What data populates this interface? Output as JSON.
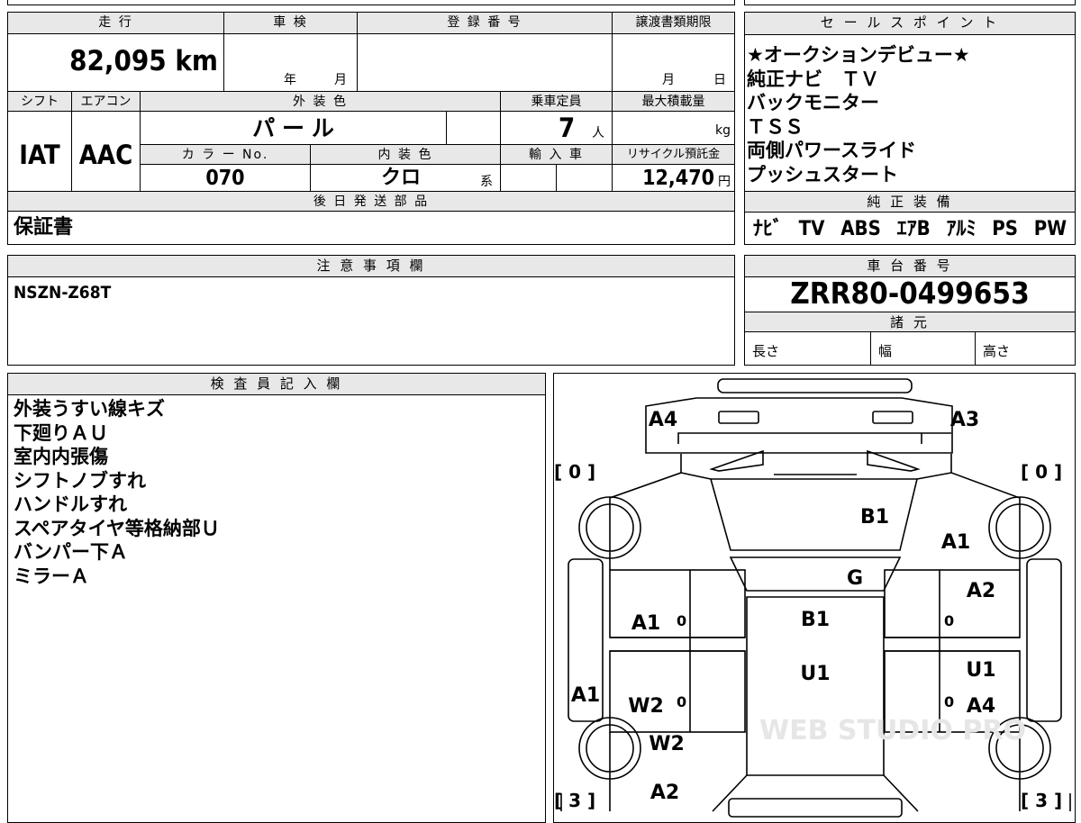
{
  "top_info": {
    "headers": {
      "mileage": "走 行",
      "inspection": "車 検",
      "registration": "登 録 番 号",
      "transfer_deadline": "譲渡書類期限"
    },
    "mileage_value": "82,095 km",
    "inspection_year": "年",
    "inspection_month": "月",
    "transfer_month": "月",
    "transfer_day": "日",
    "headers2": {
      "shift": "シフト",
      "ac": "エアコン",
      "exterior": "外 装 色",
      "capacity": "乗車定員",
      "max_load": "最大積載量"
    },
    "shift_value": "IAT",
    "ac_value": "AAC",
    "exterior_value": "パ ー ル",
    "capacity_value": "7",
    "capacity_unit": "人",
    "load_unit": "kg",
    "headers3": {
      "color_no": "カ ラ ー No.",
      "interior": "内 装 色",
      "import": "輸 入 車",
      "recycle": "リサイクル預託金"
    },
    "color_no_value": "070",
    "interior_value": "クロ",
    "interior_suffix": "系",
    "recycle_value": "12,470",
    "recycle_unit": "円"
  },
  "later_parts": {
    "header": "後 日 発 送 部 品",
    "value": "保証書"
  },
  "sales_points": {
    "header": "セ ー ル ス ポ イ ン ト",
    "lines": [
      "★オークションデビュー★",
      "純正ナビ　ＴＶ",
      "バックモニター",
      "ＴＳＳ",
      "両側パワースライド",
      "プッシュスタート"
    ]
  },
  "genuine": {
    "header": "純 正 装 備",
    "items": [
      "ﾅﾋﾞ",
      "TV",
      "ABS",
      "ｴｱB",
      "ｱﾙﾐ",
      "PS",
      "PW"
    ]
  },
  "notes": {
    "header": "注 意 事 項 欄",
    "value": "NSZN-Z68T"
  },
  "chassis": {
    "header": "車 台 番 号",
    "value": "ZRR80-0499653",
    "spec_header": "諸 元",
    "length": "長さ",
    "width": "幅",
    "height": "高さ"
  },
  "inspector": {
    "header": "検 査 員 記 入 欄",
    "lines": [
      "外装うすい線キズ",
      "下廻りＡＵ",
      "室内内張傷",
      "シフトノブすれ",
      "ハンドルすれ",
      "スペアタイヤ等格納部Ｕ",
      "バンパー下Ａ",
      "ミラーＡ"
    ]
  },
  "diagram": {
    "labels": {
      "a4_top": "A4",
      "a3_top": "A3",
      "b1_hood": "B1",
      "a1_right_fender": "A1",
      "g_glass": "G",
      "a2_right_front_door": "A2",
      "a1_left_front_door": "A1",
      "b1_roof": "B1",
      "u1_roof": "U1",
      "u1_right_rear_door": "U1",
      "a1_left_side": "A1",
      "w2_left_rear_door": "W2",
      "a4_right_rear_door": "A4",
      "w2_left_rear": "W2",
      "a2_left_rear": "A2"
    },
    "bracket_tl": "[ 0 ]",
    "bracket_tr": "[ 0 ]",
    "bracket_bl": "[ 3 ]",
    "bracket_br": "[ 3 ]",
    "zero_marks": [
      "0",
      "0",
      "0",
      "0"
    ],
    "watermark": "WEB STUDIO PRO"
  }
}
